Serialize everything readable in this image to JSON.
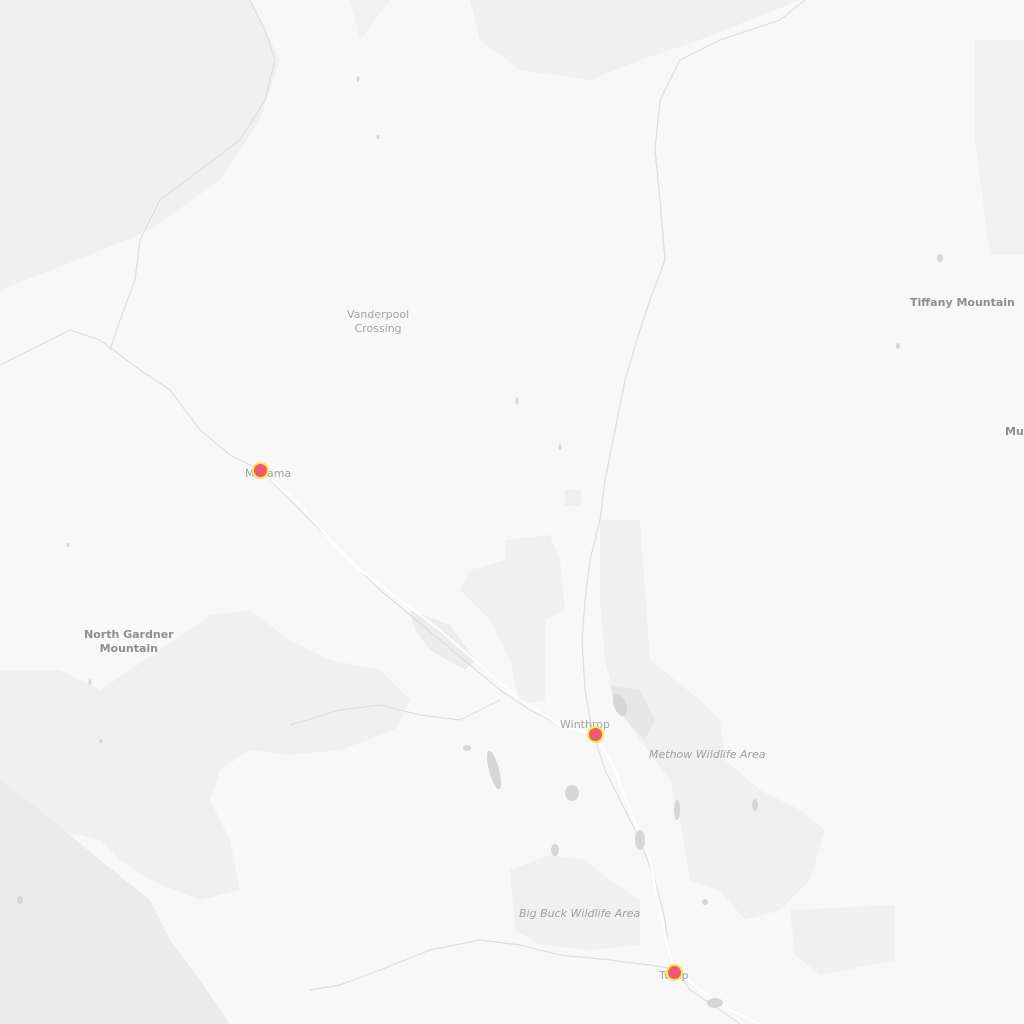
{
  "map": {
    "colors": {
      "background": "#f8f8f8",
      "terrain": "#f0f0f0",
      "terrain_dark": "#ebebeb",
      "water": "#d6d6d6",
      "river": "#dedede",
      "road": "#ffffff",
      "marker_fill": "#ef5a6f",
      "marker_ring": "#f5e94a"
    },
    "places": {
      "vanderpool_line1": "Vanderpool",
      "vanderpool_line2": "Crossing",
      "mazama": "Mazama",
      "north_gardner_line1": "North Gardner",
      "north_gardner_line2": "Mountain",
      "winthrop": "Winthrop",
      "twisp": "Twisp",
      "tiffany_mountain": "Tiffany Mountain",
      "mud_cut": "Mud"
    },
    "areas": {
      "methow_wildlife": "Methow Wildlife Area",
      "big_buck_wildlife": "Big Buck Wildlife Area"
    },
    "markers": [
      {
        "name": "Mazama",
        "icon": "map-pin-icon"
      },
      {
        "name": "Winthrop",
        "icon": "map-pin-icon"
      },
      {
        "name": "Twisp",
        "icon": "map-pin-icon"
      }
    ]
  }
}
